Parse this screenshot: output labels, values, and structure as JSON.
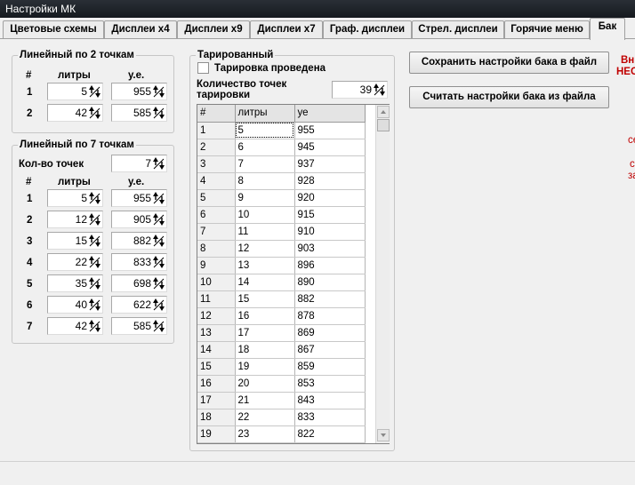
{
  "window": {
    "title": "Настройки МК"
  },
  "tabs": [
    "Цветовые схемы",
    "Дисплеи x4",
    "Дисплеи x9",
    "Дисплеи x7",
    "Граф. дисплеи",
    "Стрел. дисплеи",
    "Горячие меню",
    "Бак"
  ],
  "active_tab": "Бак",
  "linear2": {
    "title": "Линейный по 2 точкам",
    "col_num": "#",
    "col_liters": "литры",
    "col_ue": "у.е.",
    "rows": [
      {
        "n": "1",
        "liters": "5",
        "ue": "955"
      },
      {
        "n": "2",
        "liters": "42",
        "ue": "585"
      }
    ]
  },
  "linear7": {
    "title": "Линейный по 7 точкам",
    "count_label": "Кол-во точек",
    "count": "7",
    "col_num": "#",
    "col_liters": "литры",
    "col_ue": "у.е.",
    "rows": [
      {
        "n": "1",
        "liters": "5",
        "ue": "955"
      },
      {
        "n": "2",
        "liters": "12",
        "ue": "905"
      },
      {
        "n": "3",
        "liters": "15",
        "ue": "882"
      },
      {
        "n": "4",
        "liters": "22",
        "ue": "833"
      },
      {
        "n": "5",
        "liters": "35",
        "ue": "698"
      },
      {
        "n": "6",
        "liters": "40",
        "ue": "622"
      },
      {
        "n": "7",
        "liters": "42",
        "ue": "585"
      }
    ]
  },
  "tarir": {
    "title": "Тарированный",
    "checkbox_label": "Тарировка проведена",
    "checked": false,
    "points_label_1": "Количество точек",
    "points_label_2": "тарировки",
    "points": "39",
    "grid": {
      "headers": [
        "#",
        "литры",
        "уе"
      ],
      "rows": [
        [
          "1",
          "5",
          "955"
        ],
        [
          "2",
          "6",
          "945"
        ],
        [
          "3",
          "7",
          "937"
        ],
        [
          "4",
          "8",
          "928"
        ],
        [
          "5",
          "9",
          "920"
        ],
        [
          "6",
          "10",
          "915"
        ],
        [
          "7",
          "11",
          "910"
        ],
        [
          "8",
          "12",
          "903"
        ],
        [
          "9",
          "13",
          "896"
        ],
        [
          "10",
          "14",
          "890"
        ],
        [
          "11",
          "15",
          "882"
        ],
        [
          "12",
          "16",
          "878"
        ],
        [
          "13",
          "17",
          "869"
        ],
        [
          "14",
          "18",
          "867"
        ],
        [
          "15",
          "19",
          "859"
        ],
        [
          "16",
          "20",
          "853"
        ],
        [
          "17",
          "21",
          "843"
        ],
        [
          "18",
          "22",
          "833"
        ],
        [
          "19",
          "23",
          "822"
        ]
      ]
    }
  },
  "buttons": {
    "save": "Сохранить настройки бака в файл",
    "load": "Считать настройки бака из файла"
  },
  "warning": {
    "line1": "Вн",
    "line2": "НЕС",
    "line3": "се",
    "line4": "с",
    "line5": "за"
  },
  "colors": {
    "warning": "#c00000",
    "titlebar": "#1f242a"
  }
}
